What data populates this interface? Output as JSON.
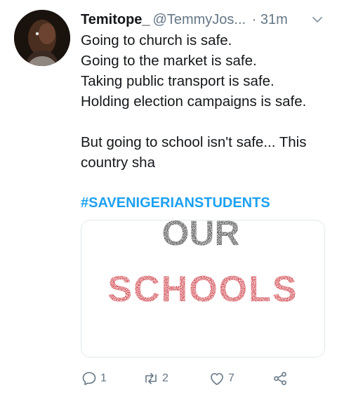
{
  "tweet": {
    "author_name": "Temitope_",
    "handle": "@TemmyJos...",
    "separator": "·",
    "time": "31m",
    "lines": [
      "Going to church is safe.",
      "Going to the market is safe.",
      "Taking public transport is safe.",
      "Holding election campaigns is safe.",
      "But going to school isn't safe... This",
      "country sha"
    ],
    "hashtag": "#SAVENIGERIANSTUDENTS",
    "media": {
      "line1": "OUR",
      "line2": "SCHOOLS"
    },
    "actions": {
      "replies": "1",
      "retweets": "2",
      "likes": "7"
    }
  },
  "colors": {
    "accent": "#1da1f2",
    "secondary_text": "#657786",
    "media_red": "#c8262f",
    "media_dark": "#2b2b2b"
  },
  "icons": [
    "avatar-image",
    "chevron-down-icon",
    "reply-icon",
    "retweet-icon",
    "like-icon",
    "share-icon"
  ]
}
